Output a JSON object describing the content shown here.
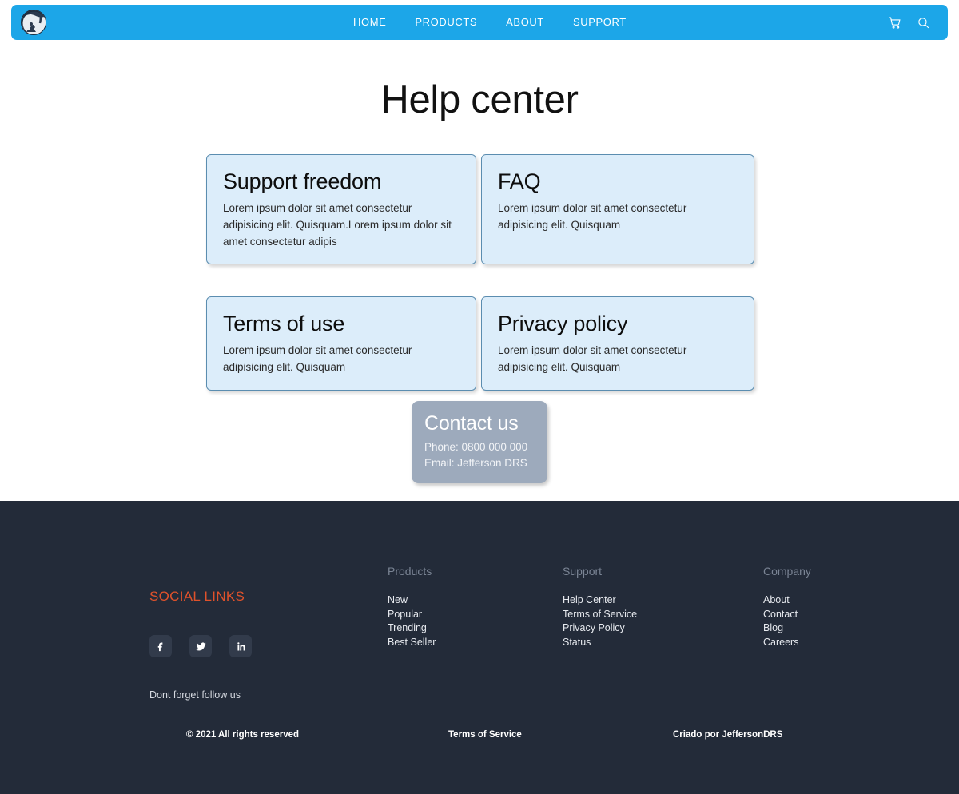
{
  "header": {
    "logo_name": "site-logo-avatar",
    "nav": [
      {
        "label": "HOME"
      },
      {
        "label": "PRODUCTS"
      },
      {
        "label": "ABOUT"
      },
      {
        "label": "SUPPORT"
      }
    ],
    "icons": [
      {
        "name": "cart-icon"
      },
      {
        "name": "search-icon"
      }
    ],
    "background_color": "#1ca6e8"
  },
  "main": {
    "title": "Help center",
    "cards": [
      {
        "title": "Support freedom",
        "body": "Lorem ipsum dolor sit amet consectetur adipisicing elit. Quisquam.Lorem ipsum dolor sit amet consectetur adipis"
      },
      {
        "title": "FAQ",
        "body": "Lorem ipsum dolor sit amet consectetur adipisicing elit. Quisquam"
      },
      {
        "title": "Terms of use",
        "body": "Lorem ipsum dolor sit amet consectetur adipisicing elit. Quisquam"
      },
      {
        "title": "Privacy policy",
        "body": "Lorem ipsum dolor sit amet consectetur adipisicing elit. Quisquam"
      }
    ],
    "card_background": "#dcedfa",
    "card_border": "#5b8db0",
    "contact": {
      "title": "Contact us",
      "phone": "Phone: 0800 000 000",
      "email": "Email: Jefferson DRS",
      "background_color": "#9daabc"
    }
  },
  "footer": {
    "background_color": "#232b39",
    "social": {
      "title": "SOCIAL LINKS",
      "title_color": "#e0522b",
      "icons": [
        {
          "name": "facebook-icon"
        },
        {
          "name": "twitter-icon"
        },
        {
          "name": "linkedin-icon"
        }
      ],
      "note": "Dont forget follow us"
    },
    "columns": [
      {
        "heading": "Products",
        "links": [
          "New",
          "Popular",
          "Trending",
          "Best Seller"
        ]
      },
      {
        "heading": "Support",
        "links": [
          "Help Center",
          "Terms of Service",
          "Privacy Policy",
          "Status"
        ]
      },
      {
        "heading": "Company",
        "links": [
          "About",
          "Contact",
          "Blog",
          "Careers"
        ]
      }
    ],
    "bottom": {
      "copyright": "© 2021 All rights reserved",
      "terms": "Terms of Service",
      "credit": "Criado por JeffersonDRS"
    }
  }
}
